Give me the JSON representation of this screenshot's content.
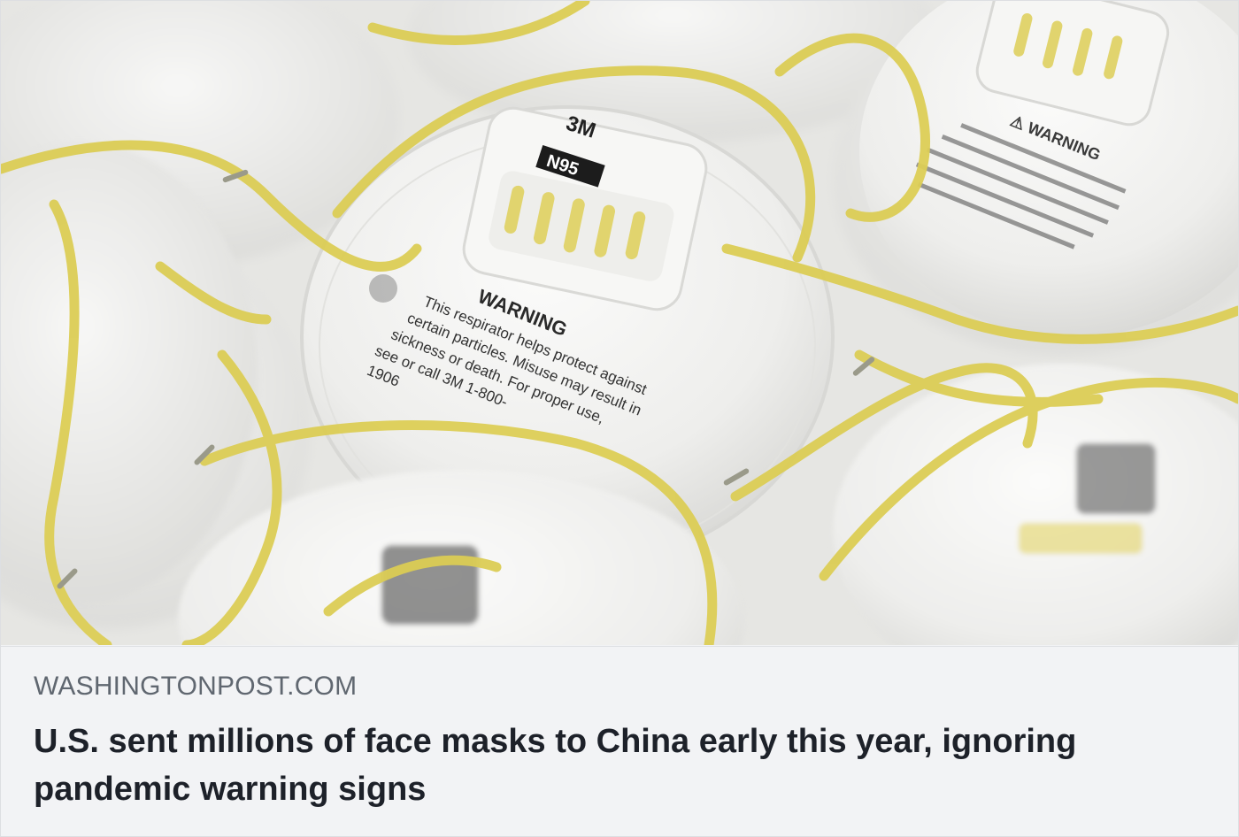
{
  "link_preview": {
    "image": {
      "alt_icon": "n95-masks-photo",
      "mask_printed_text": {
        "brand": "3M",
        "rating": "N95",
        "warning": "WARNING",
        "warning_line_1": "This respirator helps protect against",
        "warning_line_2": "certain particles. Misuse may result in",
        "warning_line_3": "sickness or death. For proper use,",
        "warning_line_4": "see or call 3M 1-800-",
        "warning_line_5": "1906"
      }
    },
    "domain": "WASHINGTONPOST.COM",
    "headline": "U.S. sent millions of face masks to China early this year, ignoring pandemic warning signs"
  },
  "colors": {
    "caption_bg": "#f2f3f5",
    "domain_text": "#606770",
    "headline_text": "#1d2129",
    "strap_yellow": "#e2d25a",
    "mask_white": "#f4f4f2"
  }
}
